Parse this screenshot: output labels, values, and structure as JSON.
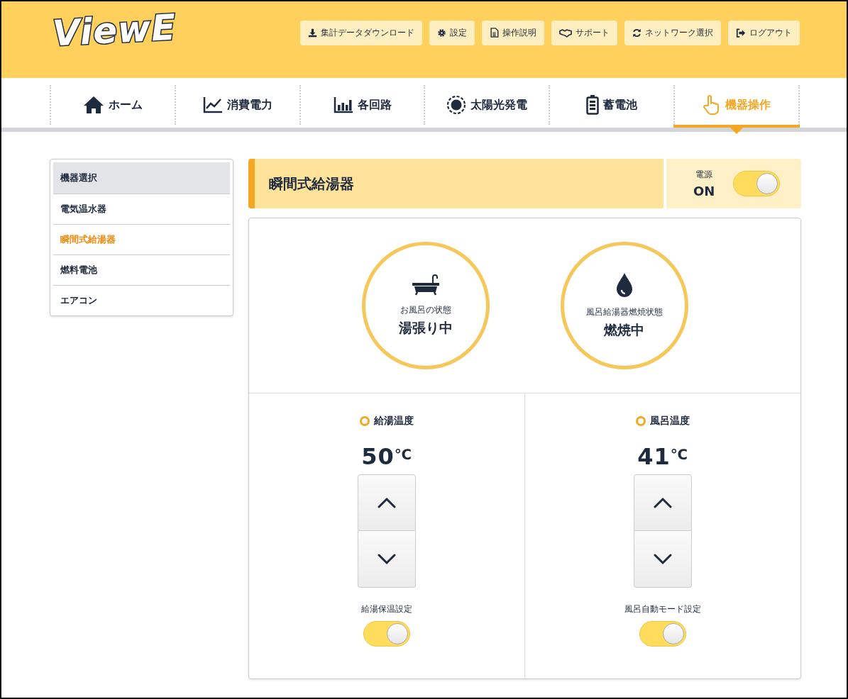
{
  "header": {
    "logo": "ViewE",
    "buttons": [
      {
        "label": "集計データダウンロード"
      },
      {
        "label": "設定"
      },
      {
        "label": "操作説明"
      },
      {
        "label": "サポート"
      },
      {
        "label": "ネットワーク選択"
      },
      {
        "label": "ログアウト"
      }
    ]
  },
  "tabs": [
    {
      "label": "ホーム",
      "selected": false
    },
    {
      "label": "消費電力",
      "selected": false
    },
    {
      "label": "各回路",
      "selected": false
    },
    {
      "label": "太陽光発電",
      "selected": false
    },
    {
      "label": "蓄電池",
      "selected": false
    },
    {
      "label": "機器操作",
      "selected": true
    }
  ],
  "sidebar": {
    "title": "機器選択",
    "items": [
      {
        "label": "電気温水器",
        "selected": false
      },
      {
        "label": "瞬間式給湯器",
        "selected": true
      },
      {
        "label": "燃料電池",
        "selected": false
      },
      {
        "label": "エアコン",
        "selected": false
      }
    ]
  },
  "device": {
    "title": "瞬間式給湯器",
    "power": {
      "label": "電源",
      "value": "ON",
      "on": true
    },
    "statuses": [
      {
        "label": "お風呂の状態",
        "value": "湯張り中"
      },
      {
        "label": "風呂給湯器燃焼状態",
        "value": "燃焼中"
      }
    ],
    "controls": [
      {
        "label": "給湯温度",
        "value": "50",
        "unit": "℃",
        "setting": {
          "label": "給湯保温設定",
          "on": true
        }
      },
      {
        "label": "風呂温度",
        "value": "41",
        "unit": "℃",
        "setting": {
          "label": "風呂自動モード設定",
          "on": true
        }
      }
    ]
  }
}
